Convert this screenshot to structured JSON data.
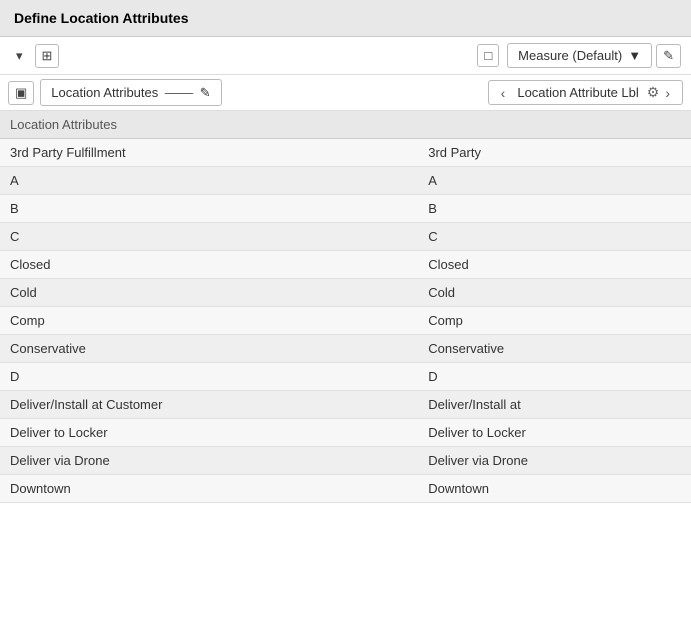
{
  "titleBar": {
    "title": "Define Location Attributes"
  },
  "toolbar": {
    "expandIcon": "▾",
    "layoutIcon": "▣",
    "squareIcon": "◫",
    "locationAttrLabel": "Location Attributes",
    "hierarchyIcon": "⑂",
    "editIcon": "✎",
    "squareIcon2": "▣",
    "measureLabel": "Measure (Default)",
    "dropdownIcon": "▾",
    "pencilIcon": "✎"
  },
  "navBar": {
    "prevIcon": "‹",
    "nextIcon": "›",
    "label": "Location Attribute Lbl",
    "settingsIcon": "⚙"
  },
  "table": {
    "col1Header": "Location Attributes",
    "col2Header": "",
    "rows": [
      {
        "col1": "3rd Party Fulfillment",
        "col2": "3rd Party"
      },
      {
        "col1": "A",
        "col2": "A"
      },
      {
        "col1": "B",
        "col2": "B"
      },
      {
        "col1": "C",
        "col2": "C"
      },
      {
        "col1": "Closed",
        "col2": "Closed"
      },
      {
        "col1": "Cold",
        "col2": "Cold"
      },
      {
        "col1": "Comp",
        "col2": "Comp"
      },
      {
        "col1": "Conservative",
        "col2": "Conservative"
      },
      {
        "col1": "D",
        "col2": "D"
      },
      {
        "col1": "Deliver/Install at Customer",
        "col2": "Deliver/Install at"
      },
      {
        "col1": "Deliver to Locker",
        "col2": "Deliver to Locker"
      },
      {
        "col1": "Deliver via Drone",
        "col2": "Deliver via Drone"
      },
      {
        "col1": "Downtown",
        "col2": "Downtown"
      }
    ]
  }
}
